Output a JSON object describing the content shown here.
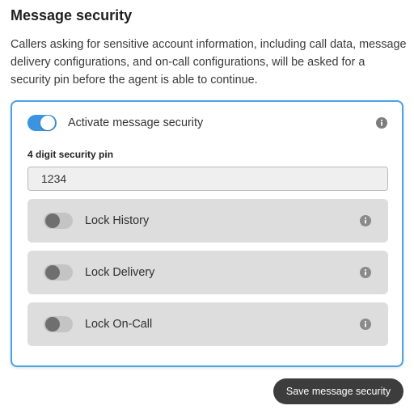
{
  "header": {
    "title": "Message security",
    "description": "Callers asking for sensitive account information, including call data, message delivery configurations, and on-call configurations, will be asked for a security pin before the agent is able to continue."
  },
  "security": {
    "activate_label": "Activate message security",
    "activate_on": true,
    "pin_label": "4 digit security pin",
    "pin_value": "1234",
    "locks": [
      {
        "label": "Lock History",
        "on": false
      },
      {
        "label": "Lock Delivery",
        "on": false
      },
      {
        "label": "Lock On-Call",
        "on": false
      }
    ]
  },
  "actions": {
    "save_label": "Save message security"
  },
  "colors": {
    "accent": "#3a94e0",
    "card_border": "#4aa3e6",
    "button_bg": "#3d3d3d"
  },
  "icons": {
    "info": "info-icon"
  }
}
